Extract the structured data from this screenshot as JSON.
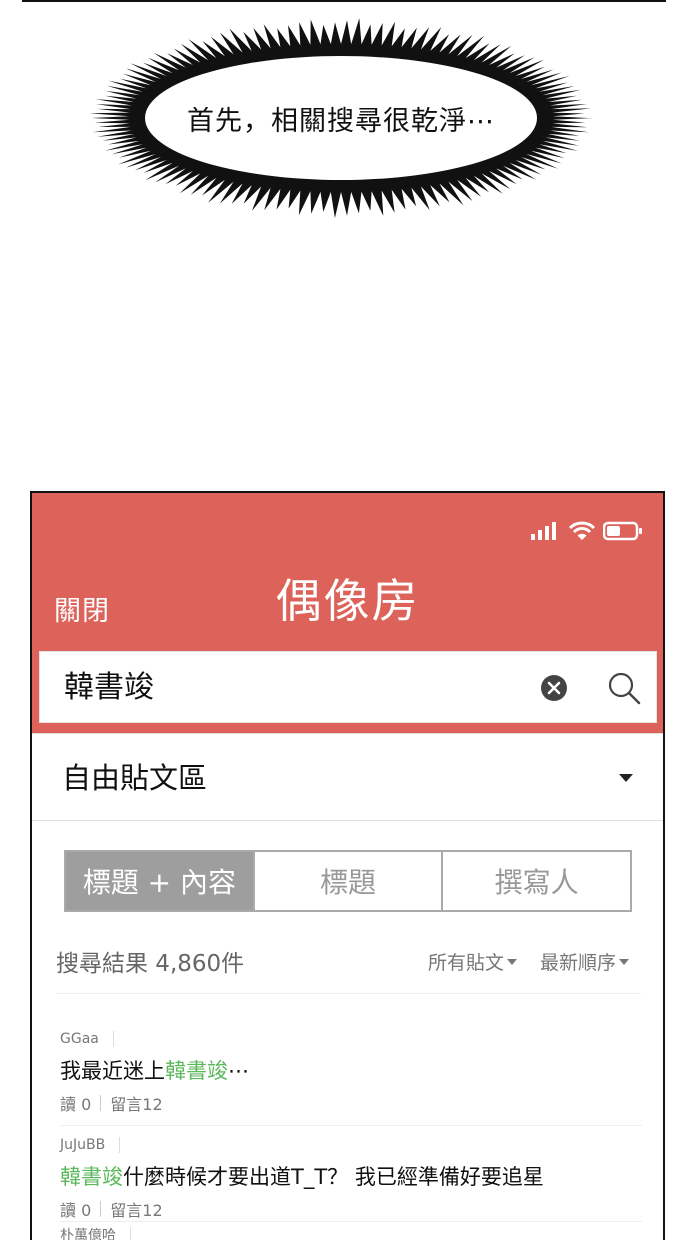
{
  "bubble": {
    "text": "首先，相關搜尋很乾淨⋯"
  },
  "app": {
    "close_label": "關閉",
    "title": "偶像房",
    "header_color": "#dc625a"
  },
  "search": {
    "value": "韓書竣"
  },
  "board": {
    "label": "自由貼文區"
  },
  "tabs": [
    "標題 + 內容",
    "標題",
    "撰寫人"
  ],
  "results": {
    "count_label": "搜尋結果 4,860件",
    "filter_all": "所有貼文",
    "sort_latest": "最新順序"
  },
  "posts": [
    {
      "author": "GGaa",
      "title_before": "我最近迷上",
      "highlight": "韓書竣",
      "title_after": "⋯",
      "reads": "讀 0",
      "comments": "留言12"
    },
    {
      "author": "JuJuBB",
      "title_before": "",
      "highlight": "韓書竣",
      "title_after": "什麼時候才要出道T_T？ 我已經準備好要追星",
      "reads": "讀 0",
      "comments": "留言12"
    },
    {
      "author": "朴萬億哈"
    }
  ],
  "icons": {
    "signal": "signal-icon",
    "wifi": "wifi-icon",
    "battery": "battery-icon",
    "clear": "clear-icon",
    "search": "search-icon",
    "dropdown": "chevron-down-icon"
  }
}
